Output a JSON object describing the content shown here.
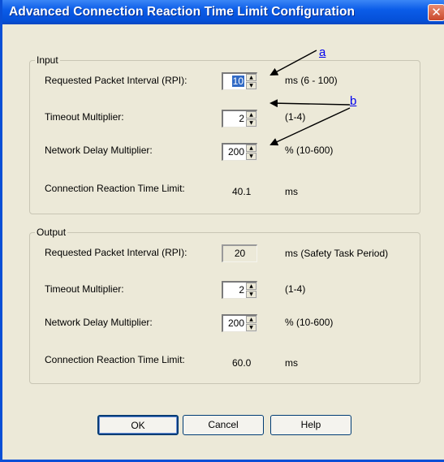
{
  "window": {
    "title": "Advanced Connection Reaction Time Limit Configuration",
    "close_symbol": "✕"
  },
  "input": {
    "legend": "Input",
    "rpi_label": "Requested Packet Interval (RPI):",
    "rpi_value": "10",
    "rpi_range": "ms (6 - 100)",
    "timeout_label": "Timeout Multiplier:",
    "timeout_value": "2",
    "timeout_range": "(1-4)",
    "delay_label": "Network Delay Multiplier:",
    "delay_value": "200",
    "delay_range": "% (10-600)",
    "limit_label": "Connection Reaction Time Limit:",
    "limit_value": "40.1",
    "limit_unit": "ms"
  },
  "output": {
    "legend": "Output",
    "rpi_label": "Requested Packet Interval (RPI):",
    "rpi_value": "20",
    "rpi_range": "ms (Safety Task Period)",
    "timeout_label": "Timeout Multiplier:",
    "timeout_value": "2",
    "timeout_range": "(1-4)",
    "delay_label": "Network Delay Multiplier:",
    "delay_value": "200",
    "delay_range": "% (10-600)",
    "limit_label": "Connection Reaction Time Limit:",
    "limit_value": "60.0",
    "limit_unit": "ms"
  },
  "buttons": {
    "ok": "OK",
    "cancel": "Cancel",
    "help": "Help"
  },
  "callouts": {
    "a": "a",
    "b": "b"
  },
  "spin_arrows": {
    "up": "▲",
    "down": "▼"
  }
}
